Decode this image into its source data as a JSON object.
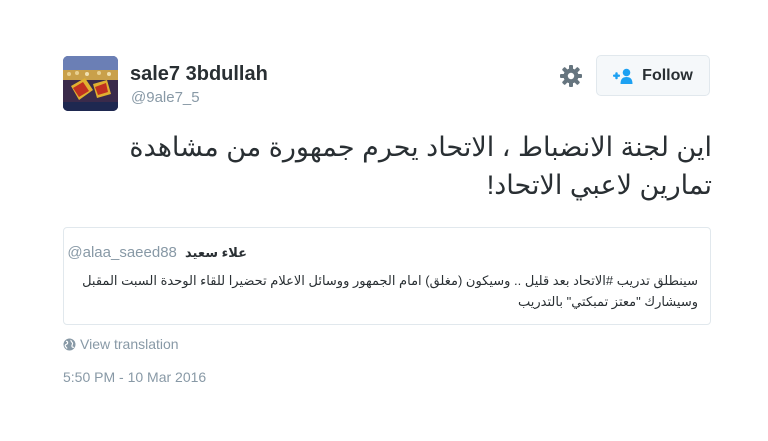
{
  "user": {
    "display_name": "sale7 3bdullah",
    "handle": "@9ale7_5",
    "avatar_icon": "avatar-crowd-image"
  },
  "actions": {
    "settings_icon": "gear-icon",
    "follow_label": "Follow",
    "follow_icon": "add-user-icon"
  },
  "tweet": {
    "text": "اين لجنة الانضباط ، الاتحاد يحرم جمهورة من مشاهدة تمارين لاعبي الاتحاد!"
  },
  "quote": {
    "name": "علاء سعيد",
    "handle": "@alaa_saeed88",
    "text": "سينطلق تدريب #الاتحاد بعد قليل .. وسيكون (مغلق) امام الجمهور ووسائل الاعلام تحضيرا للقاء الوحدة السبت المقبل وسيشارك \"معتز تمبكتي\" بالتدريب"
  },
  "footer": {
    "translation_icon": "globe-icon",
    "view_translation": "View translation",
    "timestamp": "5:50 PM - 10 Mar 2016"
  },
  "colors": {
    "text_primary": "#292f33",
    "text_secondary": "#8899a6",
    "border": "#e1e8ed",
    "button_bg": "#f5f8fa"
  }
}
